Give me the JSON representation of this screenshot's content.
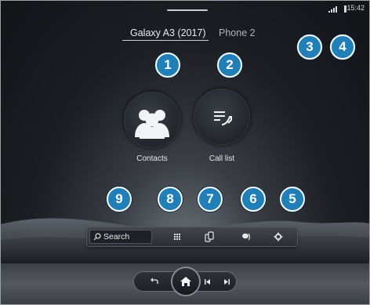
{
  "status_bar": {
    "time": "15:42",
    "signal_icon": "signal-bars-icon",
    "battery_icon": "battery-icon"
  },
  "phone_tabs": [
    {
      "label": "Galaxy A3 (2017)",
      "active": true
    },
    {
      "label": "Phone 2",
      "active": false
    }
  ],
  "main_tiles": [
    {
      "label": "Contacts",
      "icon": "contacts-group-icon"
    },
    {
      "label": "Call list",
      "icon": "call-list-icon"
    }
  ],
  "toolbar": {
    "search_label": "Search",
    "items": [
      {
        "icon": "search-icon"
      },
      {
        "icon": "keypad-icon"
      },
      {
        "icon": "phone-devices-icon"
      },
      {
        "icon": "voice-message-icon"
      },
      {
        "icon": "gear-icon"
      }
    ]
  },
  "callouts": [
    "1",
    "2",
    "3",
    "4",
    "5",
    "6",
    "7",
    "8",
    "9"
  ],
  "bottom_nav": {
    "items": [
      {
        "icon": "back-icon"
      },
      {
        "icon": "home-icon"
      },
      {
        "icon": "previous-track-icon"
      },
      {
        "icon": "next-track-icon"
      }
    ]
  },
  "colors": {
    "callout_fill": "#1f7fb6",
    "callout_border": "#ffffff",
    "background": "#1a1c21"
  }
}
